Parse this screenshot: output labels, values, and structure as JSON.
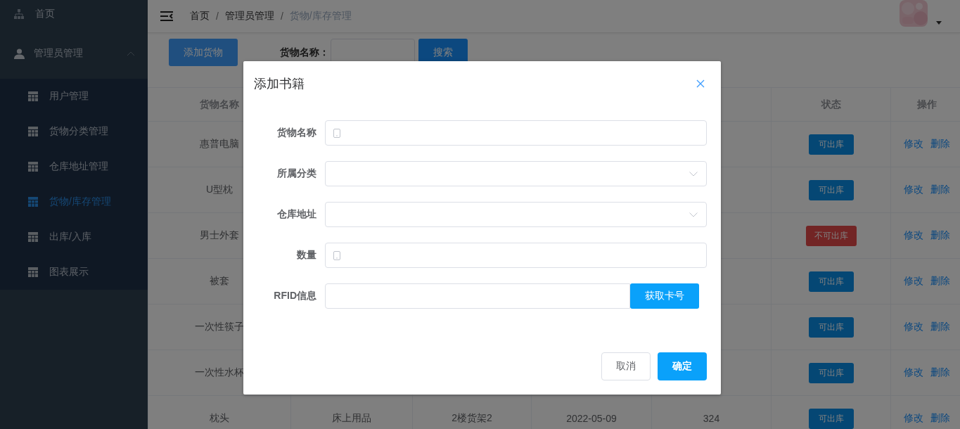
{
  "sidebar": {
    "items": [
      {
        "label": "首页",
        "kind": "link"
      },
      {
        "label": "管理员管理",
        "kind": "group",
        "expanded": true,
        "children": [
          {
            "label": "用户管理",
            "selected": false
          },
          {
            "label": "货物分类管理",
            "selected": false
          },
          {
            "label": "仓库地址管理",
            "selected": false
          },
          {
            "label": "货物/库存管理",
            "selected": true
          },
          {
            "label": "出库/入库",
            "selected": false
          },
          {
            "label": "图表展示",
            "selected": false
          }
        ]
      }
    ]
  },
  "topbar": {
    "breadcrumb": [
      "首页",
      "管理员管理",
      "货物/库存管理"
    ],
    "separator": "/"
  },
  "toolbar": {
    "add_button": "添加货物",
    "search_label": "货物名称：",
    "search_button": "搜索"
  },
  "table": {
    "header": {
      "column_1": "货物名称",
      "status": "状态",
      "actions": "操作"
    },
    "rows": [
      {
        "name": "惠普电脑",
        "status": {
          "label": "可出库",
          "kind": "available"
        },
        "actions": [
          "修改",
          "删除"
        ]
      },
      {
        "name": "U型枕",
        "status": {
          "label": "可出库",
          "kind": "available"
        },
        "actions": [
          "修改",
          "删除"
        ]
      },
      {
        "name": "男士外套",
        "status": {
          "label": "不可出库",
          "kind": "unavailable"
        },
        "actions": [
          "修改",
          "删除"
        ]
      },
      {
        "name": "被套",
        "status": {
          "label": "可出库",
          "kind": "available"
        },
        "actions": [
          "修改",
          "删除"
        ]
      },
      {
        "name": "一次性筷子",
        "status": {
          "label": "可出库",
          "kind": "available"
        },
        "actions": [
          "修改",
          "删除"
        ]
      },
      {
        "name": "一次性水杯",
        "status": {
          "label": "可出库",
          "kind": "available"
        },
        "actions": [
          "修改",
          "删除"
        ]
      },
      {
        "name": "枕头",
        "column_2": "床上用品",
        "column_3": "2楼货架2",
        "column_4": "2022-05-09",
        "column_5": "324",
        "status": {
          "label": "可出库",
          "kind": "available"
        },
        "actions": [
          "修改",
          "删除"
        ]
      }
    ]
  },
  "dialog": {
    "title": "添加书籍",
    "fields": [
      {
        "label": "货物名称",
        "kind": "text"
      },
      {
        "label": "所属分类",
        "kind": "select"
      },
      {
        "label": "仓库地址",
        "kind": "select"
      },
      {
        "label": "数量",
        "kind": "text"
      },
      {
        "label": "RFID信息",
        "kind": "rfid",
        "button": "获取卡号"
      }
    ],
    "buttons": [
      {
        "label": "取消",
        "kind": "default"
      },
      {
        "label": "确定",
        "kind": "primary"
      }
    ]
  }
}
